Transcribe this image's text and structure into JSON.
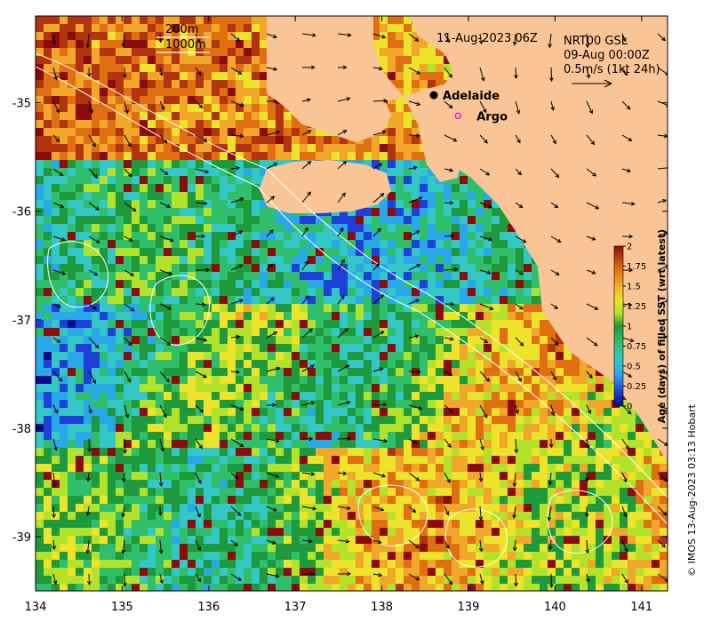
{
  "header": {
    "timestamp": "11-Aug-2023 06Z"
  },
  "scale_legend": {
    "line1": "200m",
    "line2": "1000m"
  },
  "velocity_legend": {
    "line1": "NRT00 GSL",
    "line2": "09-Aug 00:00Z",
    "line3": "0.5m/s (1kt 24h)"
  },
  "places": [
    {
      "name": "Adelaide",
      "lon": 138.6,
      "lat": -34.93,
      "marker": "filled-dot"
    },
    {
      "name": "Argo",
      "lon": 138.88,
      "lat": -35.12,
      "marker": "open-circle"
    }
  ],
  "colorbar": {
    "title": "Age (days) of filled SST (wrt latest)",
    "ticks": [
      "0",
      "0.25",
      "0.5",
      "0.75",
      "1",
      "1.25",
      "1.5",
      "1.75",
      "2"
    ],
    "min": 0,
    "max": 2
  },
  "credit": "© IMOS 13-Aug-2023 03:13 Hobart",
  "colors": {
    "land": "#f9c596",
    "arrow": "#000000",
    "contour": "#ffffff",
    "ramp": [
      "#0a0a8c",
      "#1f3fd8",
      "#28a8e6",
      "#33c7c6",
      "#2fbf6a",
      "#1e9a3c",
      "#b3e22b",
      "#ece32a",
      "#f0a72a",
      "#e06f12",
      "#b2340e",
      "#8c0c0c"
    ]
  },
  "chart_data": {
    "type": "heatmap",
    "xlim": [
      134,
      141.3
    ],
    "ylim": [
      -39.5,
      -34.2
    ],
    "xticks": [
      134,
      135,
      136,
      137,
      138,
      139,
      140,
      141
    ],
    "yticks": [
      -35,
      -36,
      -37,
      -38,
      -39
    ],
    "xtick_labels": [
      "134",
      "135",
      "136",
      "137",
      "138",
      "139",
      "140",
      "141"
    ],
    "ytick_labels": [
      "-35",
      "-36",
      "-37",
      "-38",
      "-39"
    ],
    "grid": false,
    "value_range": [
      0,
      2
    ]
  }
}
